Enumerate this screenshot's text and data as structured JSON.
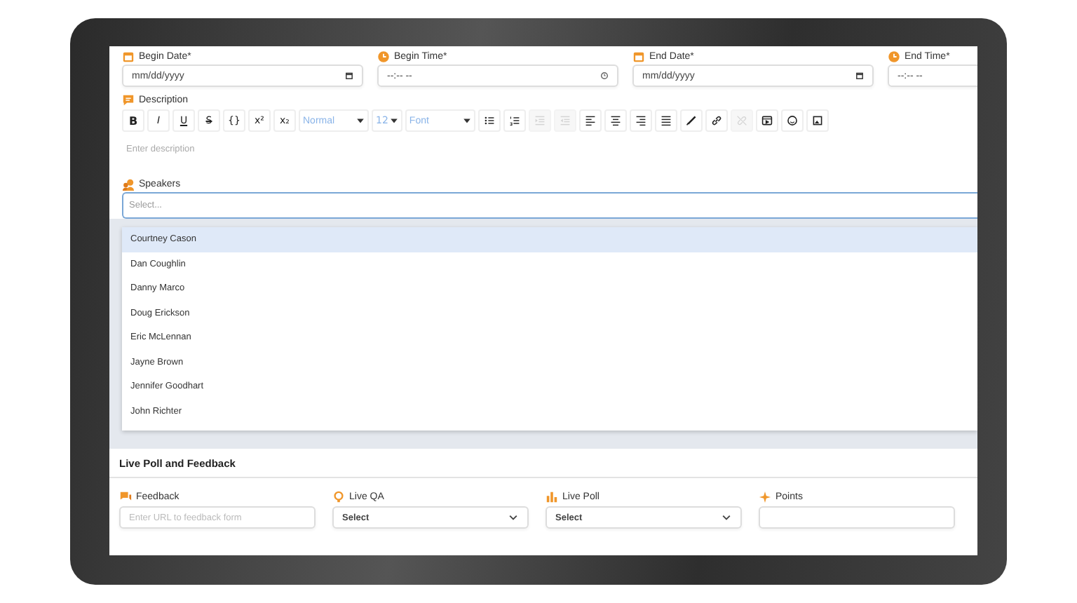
{
  "schedule_fields": [
    {
      "label": "Begin Date*",
      "kind": "date",
      "placeholder": "mm/dd/yyyy"
    },
    {
      "label": "Begin Time*",
      "kind": "time",
      "placeholder": "--:-- --"
    },
    {
      "label": "End Date*",
      "kind": "date",
      "placeholder": "mm/dd/yyyy"
    },
    {
      "label": "End Time*",
      "kind": "time",
      "placeholder": "--:-- --"
    }
  ],
  "description": {
    "label": "Description",
    "placeholder": "Enter description",
    "toolbar": [
      {
        "kind": "text",
        "text": "B",
        "disabled": false
      },
      {
        "kind": "text",
        "text": "I",
        "disabled": false
      },
      {
        "kind": "text",
        "text": "U",
        "disabled": false
      },
      {
        "kind": "text",
        "text": "S",
        "disabled": false
      },
      {
        "kind": "text",
        "text": "{}",
        "disabled": false
      },
      {
        "kind": "text",
        "text": "x²",
        "disabled": false
      },
      {
        "kind": "text",
        "text": "x₂",
        "disabled": false
      },
      {
        "kind": "select",
        "text": "Normal",
        "disabled": false
      },
      {
        "kind": "size",
        "text": "12",
        "disabled": false
      },
      {
        "kind": "select",
        "text": "Font",
        "disabled": false
      },
      {
        "kind": "bullets",
        "disabled": false
      },
      {
        "kind": "numbers",
        "disabled": false
      },
      {
        "kind": "outdent",
        "disabled": true
      },
      {
        "kind": "indent",
        "disabled": true
      },
      {
        "kind": "left",
        "disabled": false
      },
      {
        "kind": "center",
        "disabled": false
      },
      {
        "kind": "right",
        "disabled": false
      },
      {
        "kind": "justify",
        "disabled": false
      },
      {
        "kind": "pen",
        "disabled": false
      },
      {
        "kind": "link",
        "disabled": false
      },
      {
        "kind": "unlink",
        "disabled": true
      },
      {
        "kind": "media",
        "disabled": false
      },
      {
        "kind": "emoji",
        "disabled": false
      },
      {
        "kind": "image",
        "disabled": false
      }
    ]
  },
  "speakers": {
    "label": "Speakers",
    "placeholder": "Select...",
    "options": [
      {
        "name": "Courtney Cason",
        "selected": true
      },
      {
        "name": "Dan Coughlin",
        "selected": false
      },
      {
        "name": "Danny Marco",
        "selected": false
      },
      {
        "name": "Doug Erickson",
        "selected": false
      },
      {
        "name": "Eric McLennan",
        "selected": false
      },
      {
        "name": "Jayne Brown",
        "selected": false
      },
      {
        "name": "Jennifer Goodhart",
        "selected": false
      },
      {
        "name": "John Richter",
        "selected": false
      }
    ]
  },
  "live_poll": {
    "title": "Live Poll and Feedback",
    "fields": [
      {
        "label": "Feedback",
        "kind": "text",
        "placeholder": "Enter URL to feedback form"
      },
      {
        "label": "Live QA",
        "kind": "select",
        "value": "Select"
      },
      {
        "label": "Live Poll",
        "kind": "select",
        "value": "Select"
      },
      {
        "label": "Points",
        "kind": "text"
      }
    ]
  }
}
